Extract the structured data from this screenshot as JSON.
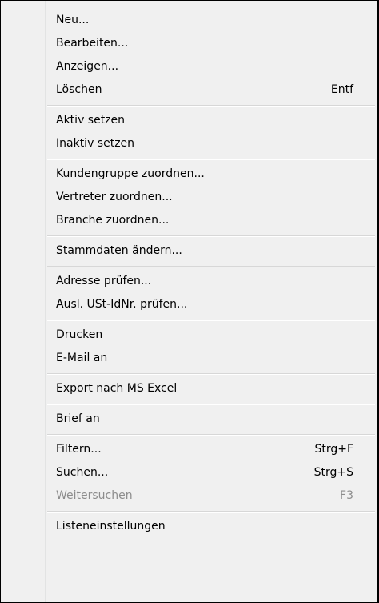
{
  "menu": {
    "groups": [
      {
        "items": [
          {
            "label": "Neu...",
            "shortcut": ""
          },
          {
            "label": "Bearbeiten...",
            "shortcut": ""
          },
          {
            "label": "Anzeigen...",
            "shortcut": ""
          },
          {
            "label": "Löschen",
            "shortcut": "Entf"
          }
        ]
      },
      {
        "items": [
          {
            "label": "Aktiv setzen",
            "shortcut": ""
          },
          {
            "label": "Inaktiv setzen",
            "shortcut": ""
          }
        ]
      },
      {
        "items": [
          {
            "label": "Kundengruppe zuordnen...",
            "shortcut": ""
          },
          {
            "label": "Vertreter zuordnen...",
            "shortcut": ""
          },
          {
            "label": "Branche zuordnen...",
            "shortcut": ""
          }
        ]
      },
      {
        "items": [
          {
            "label": "Stammdaten ändern...",
            "shortcut": ""
          }
        ]
      },
      {
        "items": [
          {
            "label": "Adresse prüfen...",
            "shortcut": ""
          },
          {
            "label": "Ausl. USt-IdNr. prüfen...",
            "shortcut": ""
          }
        ]
      },
      {
        "items": [
          {
            "label": "Drucken",
            "shortcut": ""
          },
          {
            "label": "E-Mail an",
            "shortcut": ""
          }
        ]
      },
      {
        "items": [
          {
            "label": "Export nach MS Excel",
            "shortcut": ""
          }
        ]
      },
      {
        "items": [
          {
            "label": "Brief an",
            "shortcut": ""
          }
        ]
      },
      {
        "items": [
          {
            "label": "Filtern...",
            "shortcut": "Strg+F"
          },
          {
            "label": "Suchen...",
            "shortcut": "Strg+S"
          },
          {
            "label": "Weitersuchen",
            "shortcut": "F3",
            "disabled": true
          }
        ]
      },
      {
        "items": [
          {
            "label": "Listeneinstellungen",
            "shortcut": ""
          }
        ]
      }
    ]
  }
}
